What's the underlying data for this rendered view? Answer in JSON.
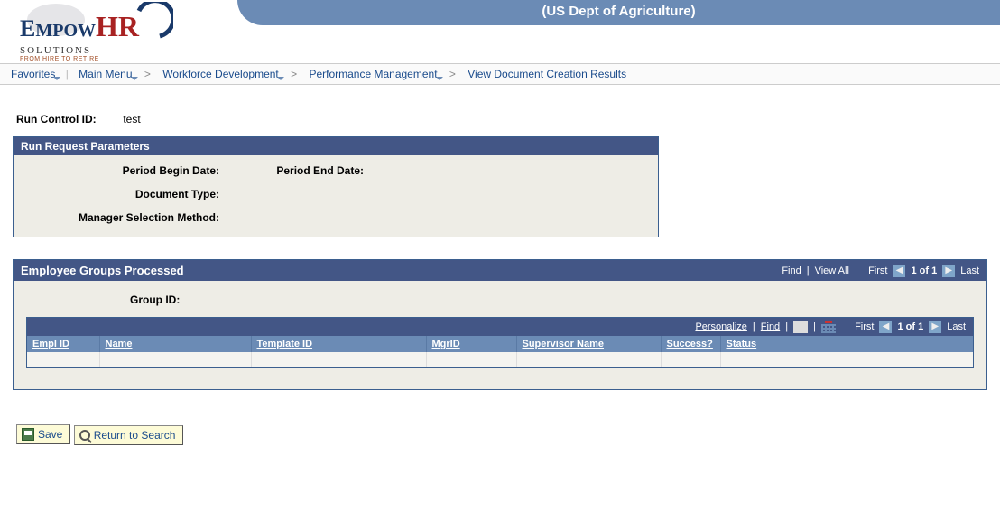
{
  "header": {
    "org_title": "(US Dept of Agriculture)",
    "logo": {
      "main": "EMPOWHR",
      "sub": "SOLUTIONS",
      "tagline": "FROM HIRE TO RETIRE"
    }
  },
  "breadcrumb": {
    "favorites": "Favorites",
    "main_menu": "Main Menu",
    "items": [
      "Workforce Development",
      "Performance Management",
      "View Document Creation Results"
    ]
  },
  "run_control": {
    "label": "Run Control ID:",
    "value": "test"
  },
  "params": {
    "header": "Run Request Parameters",
    "period_begin_label": "Period Begin Date:",
    "period_begin_value": "",
    "period_end_label": "Period End Date:",
    "period_end_value": "",
    "doc_type_label": "Document Type:",
    "doc_type_value": "",
    "mgr_sel_label": "Manager Selection Method:",
    "mgr_sel_value": ""
  },
  "groups": {
    "header": "Employee Groups Processed",
    "find": "Find",
    "view_all": "View All",
    "first": "First",
    "counter": "1 of 1",
    "last": "Last",
    "group_id_label": "Group ID:",
    "grid": {
      "personalize": "Personalize",
      "find": "Find",
      "first": "First",
      "counter": "1 of 1",
      "last": "Last",
      "columns": {
        "empl": "Empl ID",
        "name": "Name",
        "tmpl": "Template ID",
        "mgr": "MgrID",
        "sup": "Supervisor Name",
        "succ": "Success?",
        "status": "Status"
      }
    }
  },
  "buttons": {
    "save": "Save",
    "return_search": "Return to Search"
  }
}
